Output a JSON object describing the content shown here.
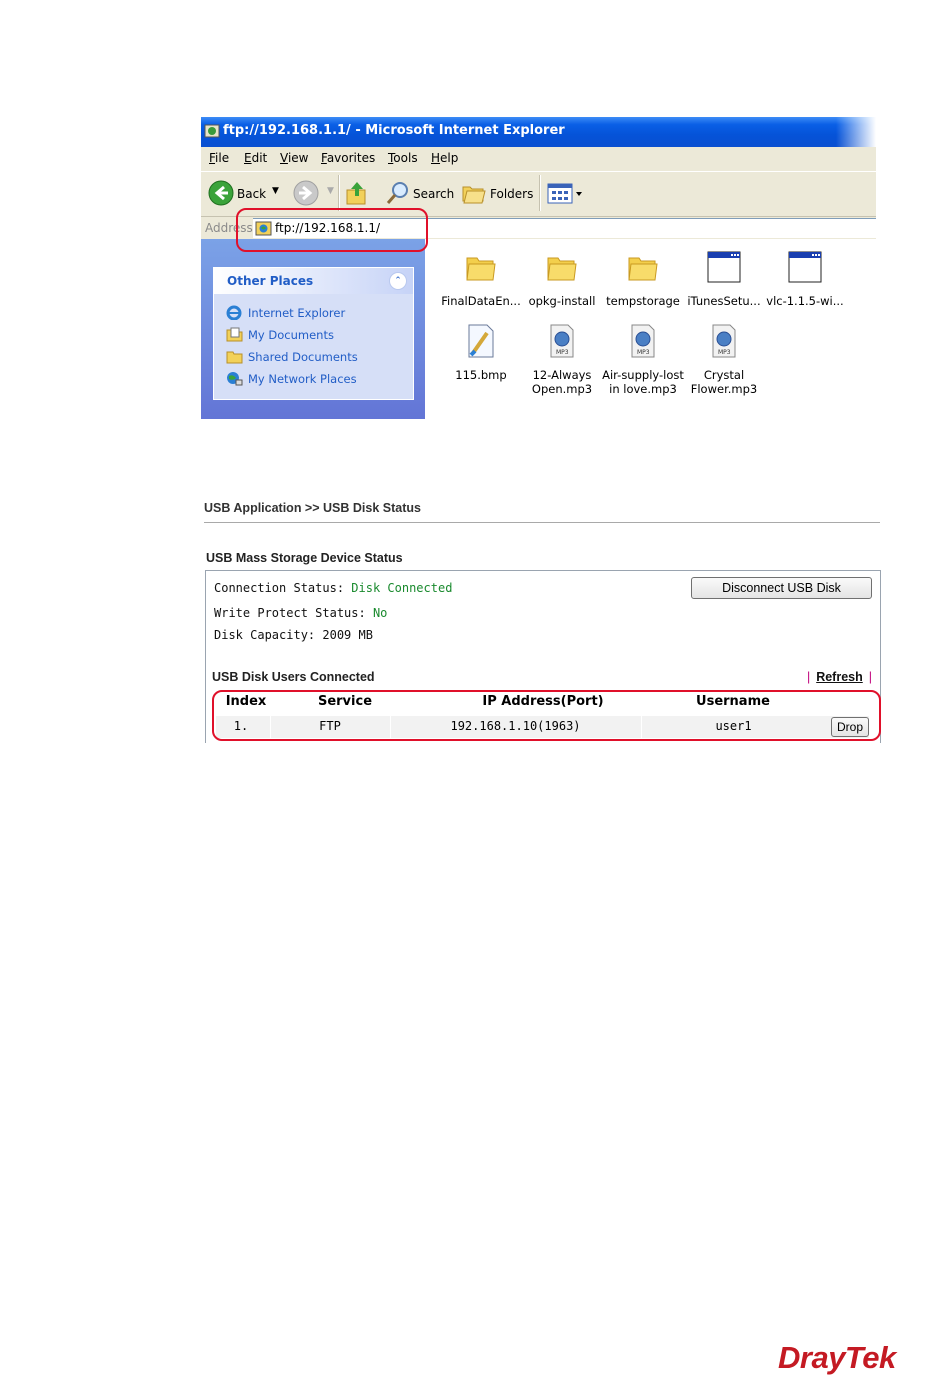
{
  "ie_window": {
    "title": "ftp://192.168.1.1/ - Microsoft Internet Explorer",
    "menu": [
      "File",
      "Edit",
      "View",
      "Favorites",
      "Tools",
      "Help"
    ],
    "toolbar": {
      "back": "Back",
      "search": "Search",
      "folders": "Folders"
    },
    "address": {
      "label": "Address",
      "value": "ftp://192.168.1.1/"
    },
    "other_places": {
      "title": "Other Places",
      "items": [
        "Internet Explorer",
        "My Documents",
        "Shared Documents",
        "My Network Places"
      ]
    },
    "files": [
      {
        "name": "FinalDataEn...",
        "type": "folder-icon"
      },
      {
        "name": "opkg-install",
        "type": "folder-icon"
      },
      {
        "name": "tempstorage",
        "type": "folder-icon"
      },
      {
        "name": "iTunesSetu...",
        "type": "application-icon"
      },
      {
        "name": "vlc-1.1.5-wi...",
        "type": "application-icon"
      },
      {
        "name": "115.bmp",
        "type": "bitmap-icon"
      },
      {
        "name": "12-Always Open.mp3",
        "type": "mp3-icon"
      },
      {
        "name": "Air-supply-lost in love.mp3",
        "type": "mp3-icon"
      },
      {
        "name": "Crystal Flower.mp3",
        "type": "mp3-icon"
      }
    ]
  },
  "usb_page": {
    "breadcrumb": "USB Application >> USB Disk Status",
    "section_title": "USB Mass Storage Device Status",
    "connection_status_label": "Connection Status:",
    "connection_status_value": "Disk Connected",
    "write_protect_label": "Write Protect Status:",
    "write_protect_value": "No",
    "disk_capacity": "Disk Capacity: 2009 MB",
    "disconnect_button": "Disconnect USB Disk",
    "users_title": "USB Disk Users Connected",
    "refresh_link": "Refresh",
    "table": {
      "headers": [
        "Index",
        "Service",
        "IP Address(Port)",
        "Username"
      ],
      "rows": [
        {
          "index": "1.",
          "service": "FTP",
          "ip": "192.168.1.10(1963)",
          "username": "user1",
          "action": "Drop"
        }
      ]
    }
  },
  "brand": {
    "logo_text": "DrayTek",
    "color": "#c41a23"
  },
  "colors": {
    "highlight_box": "#e0102a",
    "status_green": "#1a8a2e"
  }
}
